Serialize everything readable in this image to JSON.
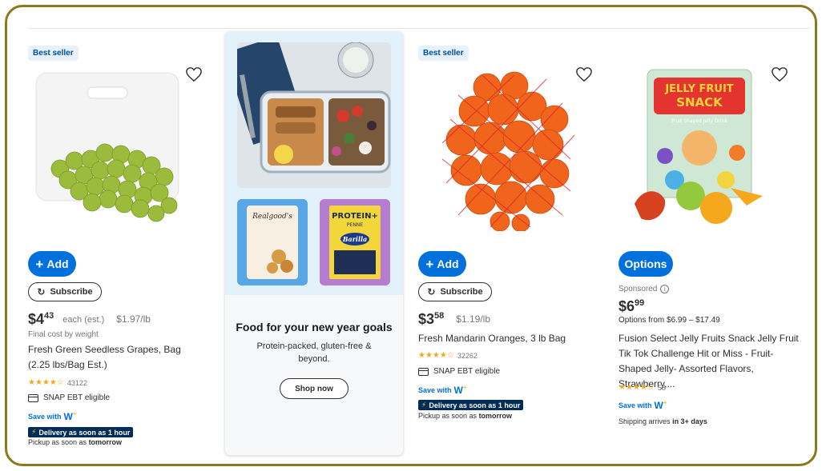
{
  "colors": {
    "frame_border": "#8a7a1c",
    "primary_blue": "#0071dc",
    "delivery_bg": "#002d58",
    "badge_bg": "#e6f1fc",
    "star": "#f2a81d"
  },
  "products": [
    {
      "badge": "Best seller",
      "add_label": "Add",
      "subscribe_label": "Subscribe",
      "price_dollars": "$4",
      "price_cents": "43",
      "price_each": "each (est.)",
      "unit_price": "$1.97/lb",
      "final_cost_note": "Final cost by weight",
      "title": "Fresh Green Seedless Grapes, Bag (2.25 lbs/Bag Est.)",
      "rating": 3.5,
      "stars": "★★★★☆",
      "review_count": "43122",
      "snap": "SNAP EBT eligible",
      "save_with": "Save with",
      "delivery": "Delivery as soon as 1 hour",
      "pickup_prefix": "Pickup as soon as",
      "pickup_time": "tomorrow"
    },
    {
      "badge": "Best seller",
      "add_label": "Add",
      "subscribe_label": "Subscribe",
      "price_dollars": "$3",
      "price_cents": "58",
      "unit_price": "$1.19/lb",
      "title": "Fresh Mandarin Oranges, 3 lb Bag",
      "rating": 3.5,
      "stars": "★★★★☆",
      "review_count": "32262",
      "snap": "SNAP EBT eligible",
      "save_with": "Save with",
      "delivery": "Delivery as soon as 1 hour",
      "pickup_prefix": "Pickup as soon as",
      "pickup_time": "tomorrow"
    },
    {
      "options_label": "Options",
      "sponsored": "Sponsored",
      "price_dollars": "$6",
      "price_cents": "99",
      "options_range": "Options from $6.99 – $17.49",
      "title": "Fusion Select Jelly Fruits Snack Jelly Fruit Tik Tok Challenge Hit or Miss - Fruit-Shaped Jelly- Assorted Flavors, Strawberry,...",
      "rating": 4,
      "stars": "★★★★☆",
      "review_count": "58",
      "save_with": "Save with",
      "shipping_prefix": "Shipping arrives",
      "shipping_time": "in 3+ days",
      "package_text_1": "JELLY FRUIT",
      "package_text_2": "SNACK",
      "package_text_3": "Fruit Shaped Jelly Drink"
    }
  ],
  "promo": {
    "title": "Food for your new year goals",
    "subtitle": "Protein-packed, gluten-free & beyond.",
    "button": "Shop now",
    "brand1": "Realgood's",
    "brand2": "PROTEIN+",
    "brand2_sub": "PENNE",
    "brand2_logo": "Barilla"
  }
}
